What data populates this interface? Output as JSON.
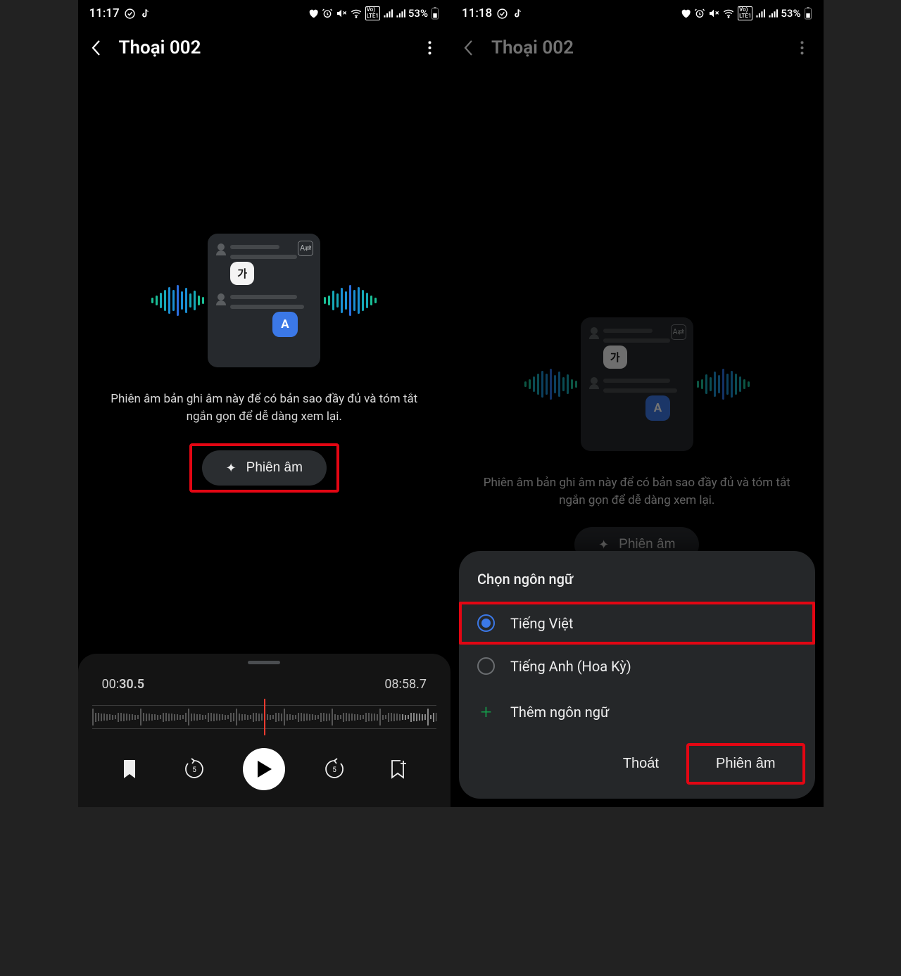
{
  "left": {
    "status": {
      "time": "11:17",
      "battery": "53%"
    },
    "header": {
      "title": "Thoại 002"
    },
    "body": {
      "description": "Phiên âm bản ghi âm này để có bản sao đầy đủ và tóm tắt ngắn gọn để dễ dàng xem lại.",
      "transcribe_label": "Phiên âm",
      "illust_bubble_ko": "가",
      "illust_bubble_a": "A"
    },
    "player": {
      "current_time_prefix": "00:",
      "current_time_emph": "30.5",
      "total_time": "08:58.7"
    }
  },
  "right": {
    "status": {
      "time": "11:18",
      "battery": "53%"
    },
    "header": {
      "title": "Thoại 002"
    },
    "body": {
      "description": "Phiên âm bản ghi âm này để có bản sao đầy đủ và tóm tắt ngắn gọn để dễ dàng xem lại.",
      "transcribe_label": "Phiên âm",
      "illust_bubble_ko": "가",
      "illust_bubble_a": "A"
    },
    "sheet": {
      "title": "Chọn ngôn ngữ",
      "option1": "Tiếng Việt",
      "option2": "Tiếng Anh (Hoa Kỳ)",
      "add": "Thêm ngôn ngữ",
      "cancel": "Thoát",
      "confirm": "Phiên âm"
    }
  }
}
